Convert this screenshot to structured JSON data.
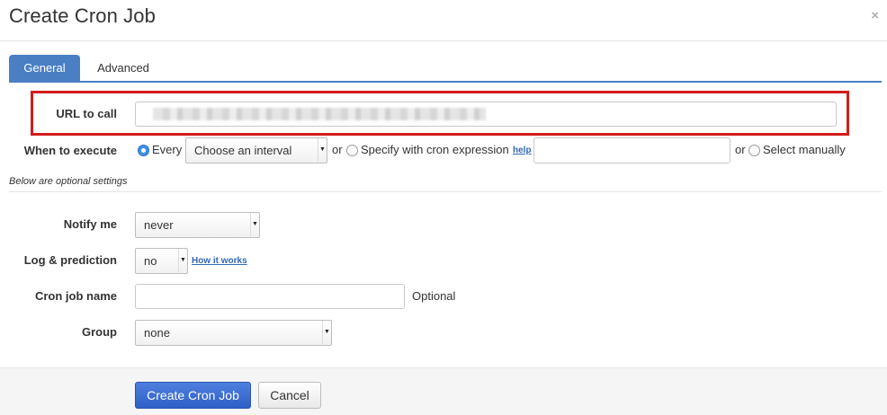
{
  "dialog": {
    "title": "Create Cron Job",
    "close_icon": "×"
  },
  "tabs": [
    {
      "label": "General",
      "active": true
    },
    {
      "label": "Advanced",
      "active": false
    }
  ],
  "form": {
    "url": {
      "label": "URL to call",
      "value": ""
    },
    "when": {
      "label": "When to execute",
      "option_every": "Every",
      "interval_select": "Choose an interval",
      "or_1": "or",
      "option_cron": "Specify with cron expression",
      "help_link": "help",
      "cron_value": "",
      "or_2": "or",
      "option_manual": "Select manually"
    },
    "optional_note": "Below are optional settings",
    "notify": {
      "label": "Notify me",
      "value": "never"
    },
    "log": {
      "label": "Log & prediction",
      "value": "no",
      "link": "How it works"
    },
    "name": {
      "label": "Cron job name",
      "value": "",
      "hint": "Optional"
    },
    "group": {
      "label": "Group",
      "value": "none"
    }
  },
  "footer": {
    "create_label": "Create Cron Job",
    "cancel_label": "Cancel"
  },
  "colors": {
    "accent": "#4a7fc4",
    "highlight_border": "#d41b1b",
    "primary_button": "#3a6bd3"
  }
}
